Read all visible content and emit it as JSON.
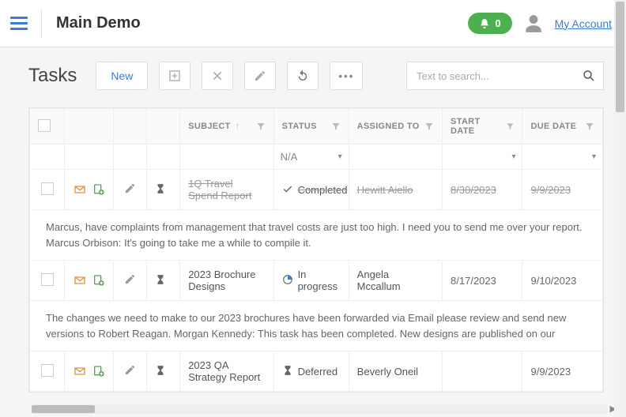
{
  "topbar": {
    "app_title": "Main Demo",
    "notification_count": "0",
    "my_account_label": "My Account"
  },
  "page": {
    "heading": "Tasks",
    "new_button": "New",
    "search_placeholder": "Text to search..."
  },
  "columns": {
    "subject": "SUBJECT",
    "status": "STATUS",
    "assigned_to": "ASSIGNED TO",
    "start_date": "START DATE",
    "due_date": "DUE DATE"
  },
  "filters": {
    "status_na": "N/A"
  },
  "rows": [
    {
      "subject": "1Q Travel Spend Report",
      "status_icon": "check-icon",
      "status": "Completed",
      "assigned_to": "Hewitt Aiello",
      "start_date": "8/30/2023",
      "due_date": "9/9/2023",
      "struck": true,
      "note": "Marcus, have complaints from management that travel costs are just too high. I need you to send me over your report. Marcus Orbison: It's going to take me a while to compile it."
    },
    {
      "subject": "2023 Brochure Designs",
      "status_icon": "progress-icon",
      "status": "In progress",
      "assigned_to": "Angela Mccallum",
      "start_date": "8/17/2023",
      "due_date": "9/10/2023",
      "struck": false,
      "note": "The changes we need to make to our 2023 brochures have been forwarded via Email please review and send new versions to Robert Reagan. Morgan Kennedy: This task has been completed. New designs are published on our"
    },
    {
      "subject": "2023 QA Strategy Report",
      "status_icon": "hourglass-icon",
      "status": "Deferred",
      "assigned_to": "Beverly Oneil",
      "start_date": "",
      "due_date": "9/9/2023",
      "struck": false,
      "note": ""
    }
  ]
}
